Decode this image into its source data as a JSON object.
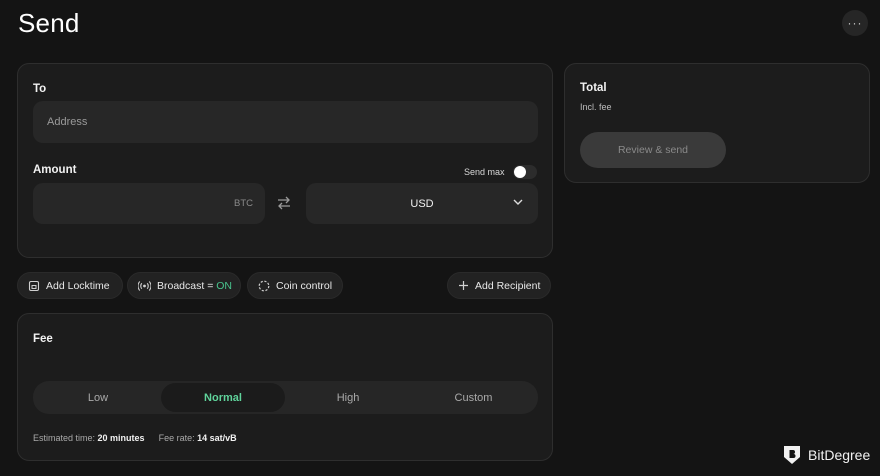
{
  "header": {
    "title": "Send",
    "more_label": "···"
  },
  "recipient": {
    "to_label": "To",
    "address_placeholder": "Address"
  },
  "amount": {
    "label": "Amount",
    "send_max_label": "Send max",
    "send_max_enabled": true,
    "btc_unit": "BTC",
    "fiat_currency": "USD"
  },
  "actions": {
    "locktime": "Add Locktime",
    "broadcast_label": "Broadcast = ",
    "broadcast_state": "ON",
    "coin_control": "Coin control",
    "add_recipient": "Add Recipient"
  },
  "total": {
    "title": "Total",
    "subtitle": "Incl. fee",
    "review_button": "Review & send"
  },
  "fee": {
    "title": "Fee",
    "options": [
      "Low",
      "Normal",
      "High",
      "Custom"
    ],
    "selected": "Normal",
    "est_time_label": "Estimated time:",
    "est_time_value": "20 minutes",
    "fee_rate_label": "Fee rate:",
    "fee_rate_value": "14 sat/vB"
  },
  "brand": {
    "name": "BitDegree"
  },
  "colors": {
    "accent": "#49c58e",
    "background": "#141414",
    "card": "#1c1c1c"
  }
}
